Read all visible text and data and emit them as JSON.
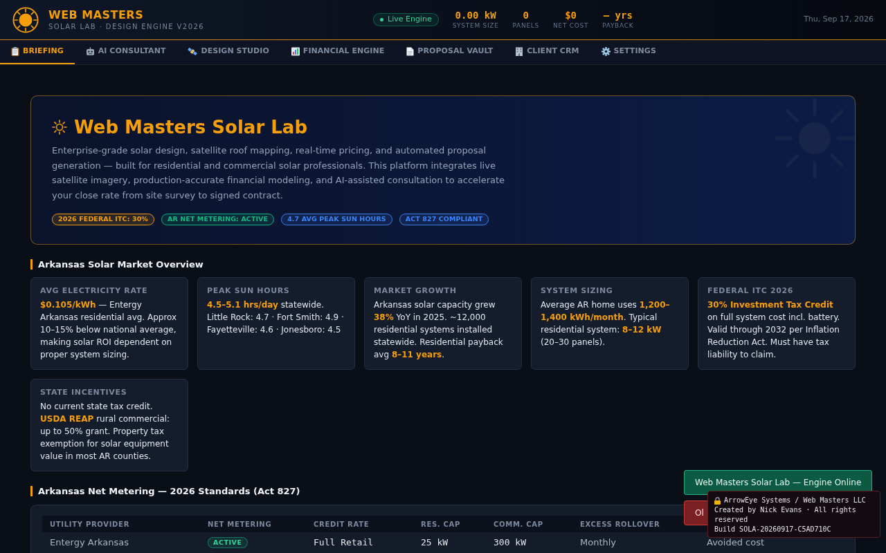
{
  "header": {
    "title": "WEB MASTERS",
    "subtitle": "SOLAR LAB · DESIGN ENGINE V2026",
    "engine_status": {
      "label": "Live Engine",
      "on": true
    },
    "stats": [
      {
        "value": "0.00 kW",
        "label": "SYSTEM SIZE"
      },
      {
        "value": "0",
        "label": "PANELS"
      },
      {
        "value": "$0",
        "label": "NET COST"
      },
      {
        "value": "— yrs",
        "label": "PAYBACK"
      }
    ],
    "date": "Thu, Sep 17, 2026"
  },
  "tabs": [
    {
      "label": "BRIEFING",
      "selected": true
    },
    {
      "label": "AI CONSULTANT",
      "selected": false
    },
    {
      "label": "DESIGN STUDIO",
      "selected": false
    },
    {
      "label": "FINANCIAL ENGINE",
      "selected": false
    },
    {
      "label": "PROPOSAL VAULT",
      "selected": false
    },
    {
      "label": "CLIENT CRM",
      "selected": false
    },
    {
      "label": "SETTINGS",
      "selected": false
    }
  ],
  "hero": {
    "title": "Web Masters Solar Lab",
    "description": "Enterprise-grade solar design, satellite roof mapping, real-time pricing, and automated proposal generation — built for residential and commercial solar professionals. This platform integrates live satellite imagery, production-accurate financial modeling, and AI-assisted consultation to accelerate your close rate from site survey to signed contract.",
    "badges": [
      {
        "label": "2026 FEDERAL ITC: 30%",
        "color": "#f59e0b"
      },
      {
        "label": "AR NET METERING: ACTIVE",
        "color": "#10b981"
      },
      {
        "label": "4.7 AVG PEAK SUN HOURS",
        "color": "#3b82f6"
      },
      {
        "label": "ACT 827 COMPLIANT",
        "color": "#3b82f6"
      }
    ]
  },
  "market_overview": {
    "heading": "Arkansas Solar Market Overview",
    "cards": [
      {
        "label": "AVG ELECTRICITY RATE",
        "text": "**$0.105/kWh** — Entergy Arkansas residential avg. Approx 10–15% below national average, making solar ROI dependent on proper system sizing."
      },
      {
        "label": "PEAK SUN HOURS",
        "text": "**4.5–5.1 hrs/day** statewide. Little Rock: 4.7 · Fort Smith: 4.9 · Fayetteville: 4.6 · Jonesboro: 4.5"
      },
      {
        "label": "MARKET GROWTH",
        "text": "Arkansas solar capacity grew **38%** YoY in 2025. ~12,000 residential systems installed statewide. Residential payback avg **8–11 years**."
      },
      {
        "label": "SYSTEM SIZING",
        "text": "Average AR home uses **1,200–1,400 kWh/month**. Typical residential system: **8–12 kW** (20–30 panels)."
      },
      {
        "label": "FEDERAL ITC 2026",
        "text": "**30% Investment Tax Credit** on full system cost incl. battery. Valid through 2032 per Inflation Reduction Act. Must have tax liability to claim."
      },
      {
        "label": "STATE INCENTIVES",
        "text": "No current state tax credit. **USDA REAP** rural commercial: up to 50% grant. Property tax exemption for solar equipment value in most AR counties."
      }
    ]
  },
  "net_metering": {
    "heading": "Arkansas Net Metering — 2026 Standards (Act 827)",
    "table": {
      "columns": [
        {
          "label": "UTILITY PROVIDER",
          "kind": "text"
        },
        {
          "label": "NET METERING",
          "kind": "badge"
        },
        {
          "label": "CREDIT RATE",
          "kind": "mono"
        },
        {
          "label": "RES. CAP",
          "kind": "mono"
        },
        {
          "label": "COMM. CAP",
          "kind": "mono"
        },
        {
          "label": "EXCESS ROLLOVER",
          "kind": "text"
        },
        {
          "kind": "text"
        }
      ],
      "rows": [
        [
          "Entergy Arkansas",
          "ACTIVE",
          "Full Retail",
          "25 kW",
          "300 kW",
          "Monthly",
          "Avoided cost"
        ]
      ]
    }
  },
  "toasts": [
    {
      "text": "Web Masters Solar Lab — Engine Online",
      "kind": "success"
    },
    {
      "text": "Ol",
      "kind": "error"
    }
  ],
  "build_info": {
    "owner": "ArrowEye Systems / Web Masters LLC",
    "credit": "Created by Nick Evans · All rights reserved",
    "build": "Build SOLA-20260917-C5AD710C"
  }
}
